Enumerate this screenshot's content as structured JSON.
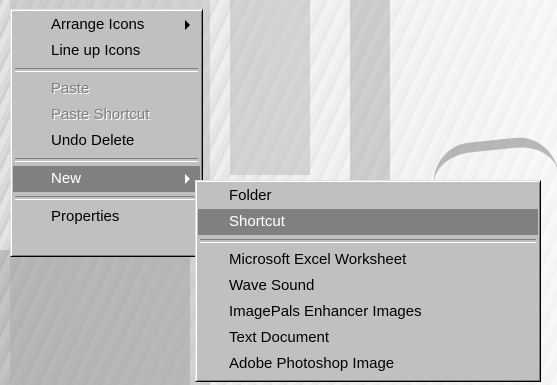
{
  "context_menu": {
    "items": [
      {
        "label": "Arrange Icons",
        "has_submenu": true
      },
      {
        "label": "Line up Icons"
      },
      {
        "label": "Paste",
        "disabled": true
      },
      {
        "label": "Paste Shortcut",
        "disabled": true
      },
      {
        "label": "Undo Delete"
      },
      {
        "label": "New",
        "has_submenu": true,
        "selected": true
      },
      {
        "label": "Properties"
      }
    ]
  },
  "new_submenu": {
    "items": [
      {
        "label": "Folder"
      },
      {
        "label": "Shortcut",
        "selected": true
      },
      {
        "label": "Microsoft Excel Worksheet"
      },
      {
        "label": "Wave Sound"
      },
      {
        "label": "ImagePals Enhancer Images"
      },
      {
        "label": "Text Document"
      },
      {
        "label": "Adobe Photoshop Image"
      }
    ]
  },
  "colors": {
    "menu_bg": "#c0c0c0",
    "highlight": "#808080",
    "disabled_text": "#808080"
  }
}
